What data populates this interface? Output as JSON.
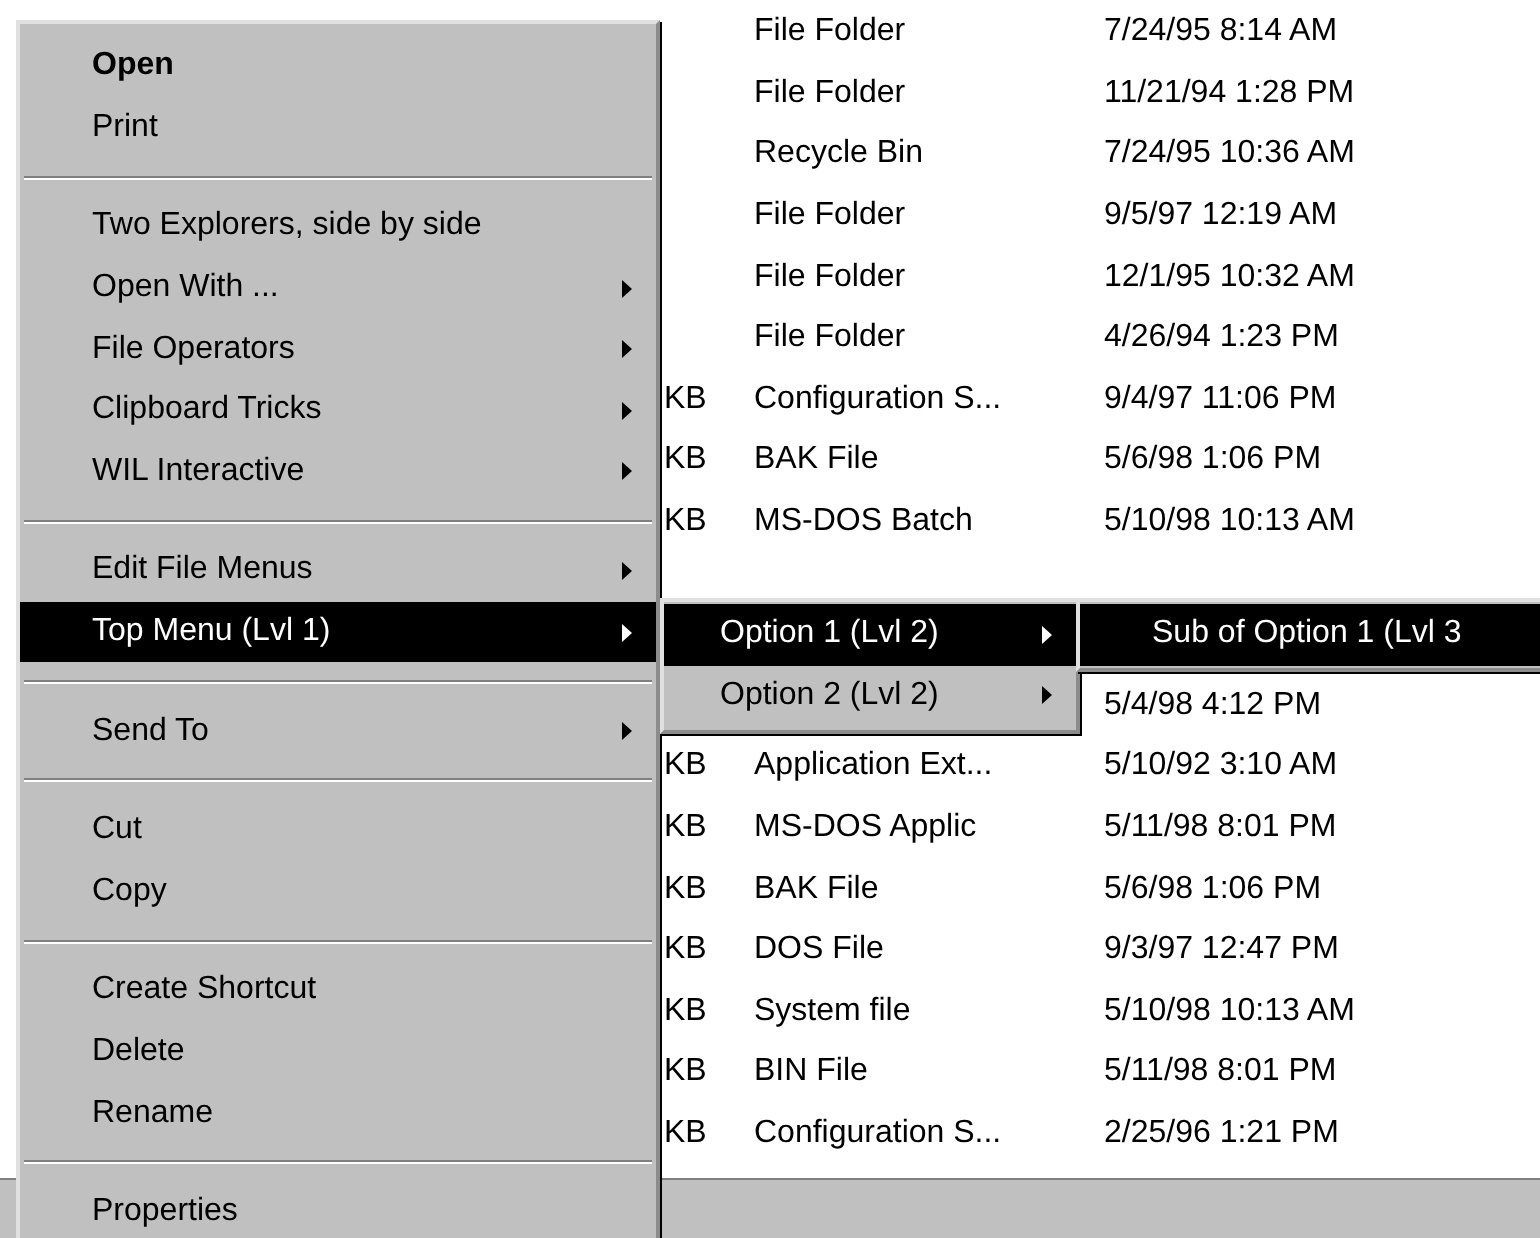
{
  "file_list": {
    "rows": [
      {
        "type": "File Folder",
        "modified": "7/24/95 8:14 AM"
      },
      {
        "type": "File Folder",
        "modified": "11/21/94 1:28 PM"
      },
      {
        "type": "Recycle Bin",
        "modified": "7/24/95 10:36 AM"
      },
      {
        "type": "File Folder",
        "modified": "9/5/97 12:19 AM"
      },
      {
        "type": "File Folder",
        "modified": "12/1/95 10:32 AM"
      },
      {
        "type": "File Folder",
        "modified": "4/26/94 1:23 PM"
      },
      {
        "size": "KB",
        "type": "Configuration S...",
        "modified": "9/4/97 11:06 PM"
      },
      {
        "size": "KB",
        "type": "BAK File",
        "modified": "5/6/98 1:06 PM"
      },
      {
        "size": "KB",
        "type": "MS-DOS Batch",
        "modified": "5/10/98 10:13 AM"
      },
      {},
      {},
      {
        "modified": "5/4/98 4:12 PM"
      },
      {
        "size": "KB",
        "type": "Application Ext...",
        "modified": "5/10/92 3:10 AM"
      },
      {
        "size": "KB",
        "type": "MS-DOS Applic",
        "modified": "5/11/98 8:01 PM"
      },
      {
        "size": "KB",
        "type": "BAK File",
        "modified": "5/6/98 1:06 PM"
      },
      {
        "size": "KB",
        "type": "DOS File",
        "modified": "9/3/97 12:47 PM"
      },
      {
        "size": "KB",
        "type": "System file",
        "modified": "5/10/98 10:13 AM"
      },
      {
        "size": "KB",
        "type": "BIN File",
        "modified": "5/11/98 8:01 PM"
      },
      {
        "size": "KB",
        "type": "Configuration S...",
        "modified": "2/25/96 1:21 PM"
      }
    ]
  },
  "context_menu": {
    "items": [
      {
        "kind": "item",
        "label": "Open",
        "bold": true,
        "submenu": false,
        "selected": false
      },
      {
        "kind": "item",
        "label": "Print",
        "bold": false,
        "submenu": false,
        "selected": false
      },
      {
        "kind": "separator"
      },
      {
        "kind": "item",
        "label": "Two Explorers, side by side",
        "bold": false,
        "submenu": false,
        "selected": false
      },
      {
        "kind": "item",
        "label": "Open With ...",
        "bold": false,
        "submenu": true,
        "selected": false
      },
      {
        "kind": "item",
        "label": "File Operators",
        "bold": false,
        "submenu": true,
        "selected": false
      },
      {
        "kind": "item",
        "label": "Clipboard Tricks",
        "bold": false,
        "submenu": true,
        "selected": false
      },
      {
        "kind": "item",
        "label": "WIL Interactive",
        "bold": false,
        "submenu": true,
        "selected": false
      },
      {
        "kind": "separator"
      },
      {
        "kind": "item",
        "label": "Edit File Menus",
        "bold": false,
        "submenu": true,
        "selected": false
      },
      {
        "kind": "item",
        "label": "Top Menu (Lvl 1)",
        "bold": false,
        "submenu": true,
        "selected": true
      },
      {
        "kind": "separator"
      },
      {
        "kind": "item",
        "label": "Send To",
        "bold": false,
        "submenu": true,
        "selected": false
      },
      {
        "kind": "separator"
      },
      {
        "kind": "item",
        "label": "Cut",
        "bold": false,
        "submenu": false,
        "selected": false
      },
      {
        "kind": "item",
        "label": "Copy",
        "bold": false,
        "submenu": false,
        "selected": false
      },
      {
        "kind": "separator"
      },
      {
        "kind": "item",
        "label": "Create Shortcut",
        "bold": false,
        "submenu": false,
        "selected": false
      },
      {
        "kind": "item",
        "label": "Delete",
        "bold": false,
        "submenu": false,
        "selected": false
      },
      {
        "kind": "item",
        "label": "Rename",
        "bold": false,
        "submenu": false,
        "selected": false
      },
      {
        "kind": "separator"
      },
      {
        "kind": "item",
        "label": "Properties",
        "bold": false,
        "submenu": false,
        "selected": false
      }
    ]
  },
  "submenu_level_2": {
    "items": [
      {
        "kind": "item",
        "label": "Option 1 (Lvl 2)",
        "submenu": true,
        "selected": true
      },
      {
        "kind": "item",
        "label": "Option 2 (Lvl 2)",
        "submenu": true,
        "selected": false
      }
    ]
  },
  "submenu_level_3": {
    "items": [
      {
        "kind": "item",
        "label": "Sub of Option 1 (Lvl 3",
        "selected": true
      }
    ]
  }
}
